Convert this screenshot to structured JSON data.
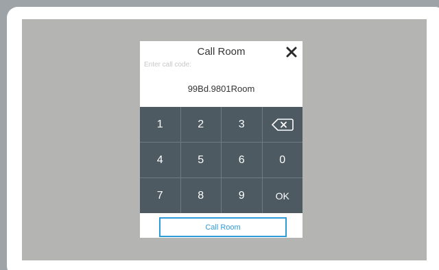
{
  "dialog": {
    "title": "Call Room",
    "prompt": "Enter call code:",
    "code_value": "99Bd.9801Room",
    "call_button_label": "Call Room"
  },
  "keypad": {
    "keys": [
      "1",
      "2",
      "3",
      "4",
      "5",
      "6",
      "0",
      "7",
      "8",
      "9",
      "OK"
    ],
    "backspace_icon": "backspace-icon"
  },
  "colors": {
    "key_bg": "#4d5a62",
    "accent": "#2d9ad8",
    "screen_bg": "#b4b5b3"
  }
}
